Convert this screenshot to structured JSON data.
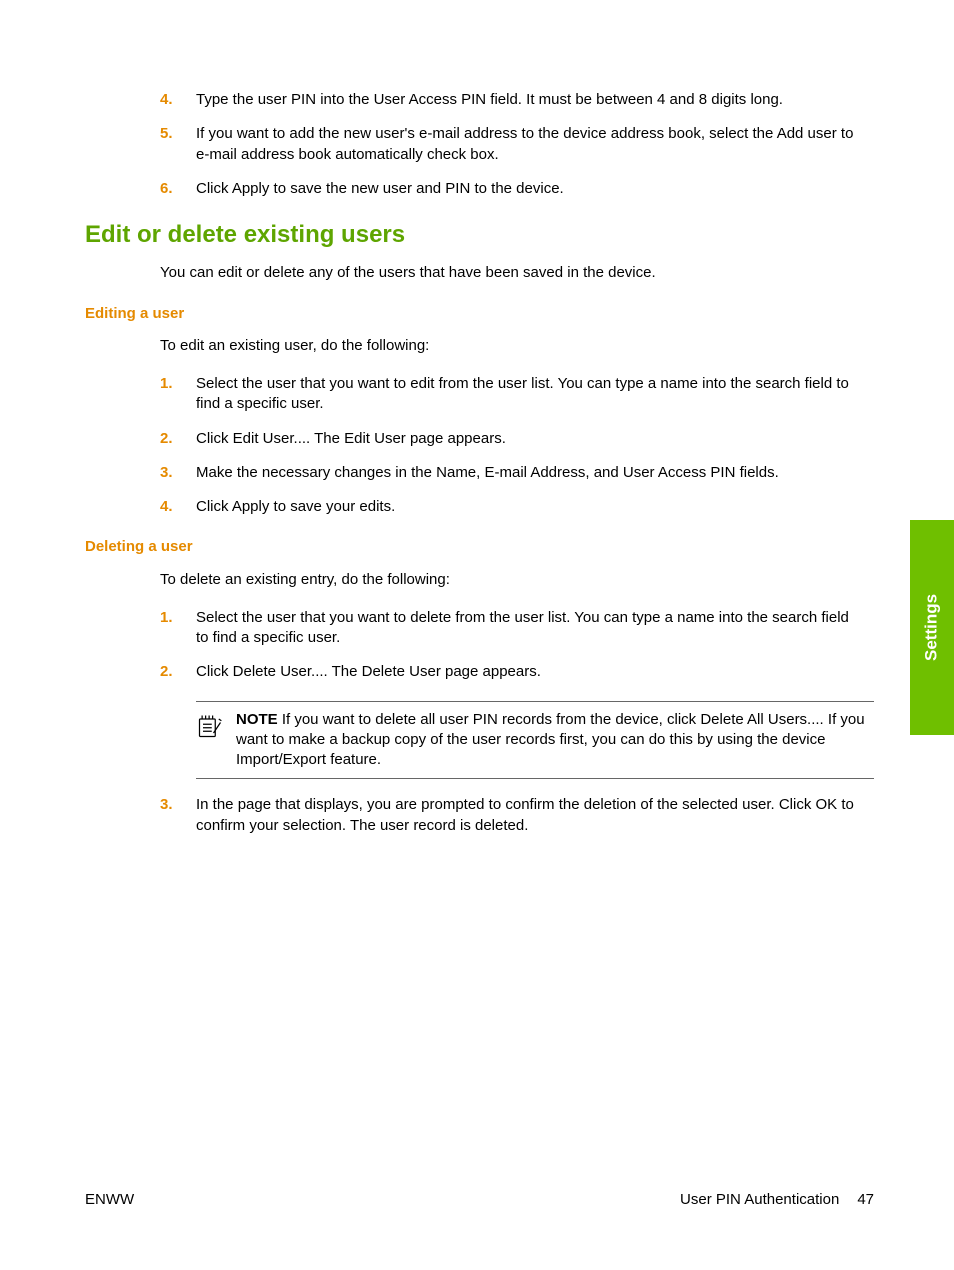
{
  "topList": {
    "items": [
      {
        "num": "4.",
        "text": "Type the user PIN into the User Access PIN field. It must be between 4 and 8 digits long."
      },
      {
        "num": "5.",
        "text": "If you want to add the new user's e-mail address to the device address book, select the Add user to e-mail address book automatically check box."
      },
      {
        "num": "6.",
        "text": "Click Apply to save the new user and PIN to the device."
      }
    ]
  },
  "h2": "Edit or delete existing users",
  "h2Body": "You can edit or delete any of the users that have been saved in the device.",
  "editing": {
    "heading": "Editing a user",
    "intro": "To edit an existing user, do the following:",
    "items": [
      {
        "num": "1.",
        "text": "Select the user that you want to edit from the user list. You can type a name into the search field to find a specific user."
      },
      {
        "num": "2.",
        "text": "Click Edit User.... The Edit User page appears."
      },
      {
        "num": "3.",
        "text": "Make the necessary changes in the Name, E-mail Address, and User Access PIN fields."
      },
      {
        "num": "4.",
        "text": "Click Apply to save your edits."
      }
    ]
  },
  "deleting": {
    "heading": "Deleting a user",
    "intro": "To delete an existing entry, do the following:",
    "items1": [
      {
        "num": "1.",
        "text": "Select the user that you want to delete from the user list. You can type a name into the search field to find a specific user."
      },
      {
        "num": "2.",
        "text": "Click Delete User.... The Delete User page appears."
      }
    ],
    "note": {
      "label": "NOTE",
      "text": "   If you want to delete all user PIN records from the device, click Delete All Users.... If you want to make a backup copy of the user records first, you can do this by using the device Import/Export feature."
    },
    "items2": [
      {
        "num": "3.",
        "text": "In the page that displays, you are prompted to confirm the deletion of the selected user. Click OK to confirm your selection. The user record is deleted."
      }
    ]
  },
  "sideTab": "Settings",
  "footer": {
    "left": "ENWW",
    "rightLabel": "User PIN Authentication",
    "pageNum": "47"
  }
}
